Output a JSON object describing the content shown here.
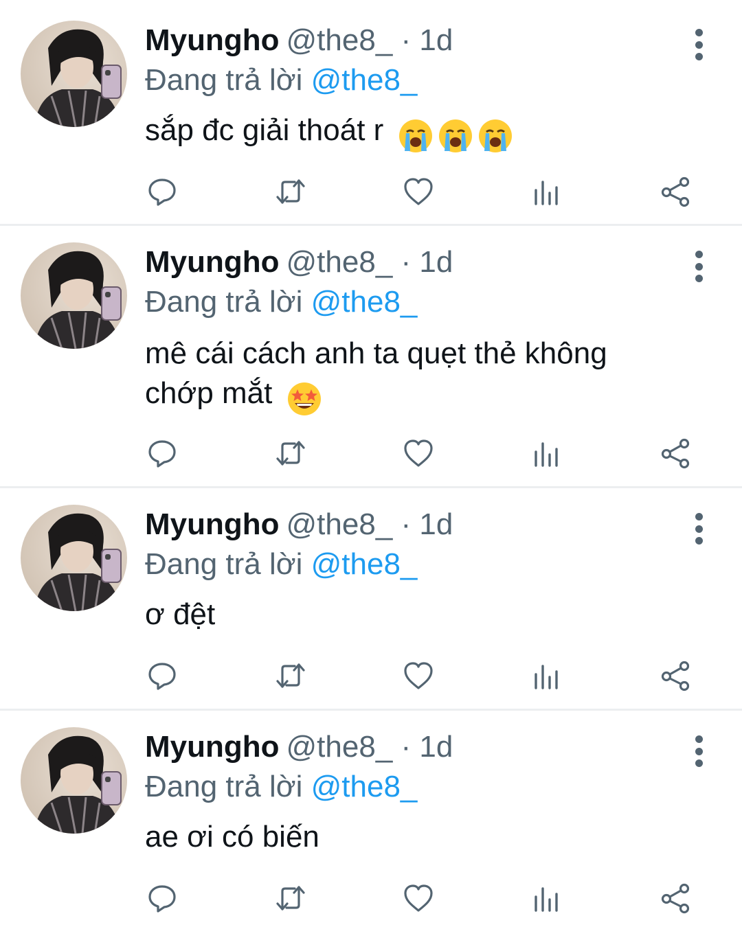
{
  "tweets": [
    {
      "name": "Myungho",
      "handle_time": "@the8_ · 1d",
      "reply_prefix": "Đang trả lời",
      "reply_to": "@the8_",
      "text": "sắp đc giải thoát r",
      "emojis": [
        "loudly-crying-face-emoji",
        "loudly-crying-face-emoji",
        "loudly-crying-face-emoji"
      ]
    },
    {
      "name": "Myungho",
      "handle_time": "@the8_ · 1d",
      "reply_prefix": "Đang trả lời",
      "reply_to": "@the8_",
      "text_line1": "mê cái cách anh ta quẹt thẻ không",
      "text_line2": "chớp mắt",
      "emojis": [
        "star-struck-emoji"
      ]
    },
    {
      "name": "Myungho",
      "handle_time": "@the8_ · 1d",
      "reply_prefix": "Đang trả lời",
      "reply_to": "@the8_",
      "text": "ơ đệt"
    },
    {
      "name": "Myungho",
      "handle_time": "@the8_ · 1d",
      "reply_prefix": "Đang trả lời",
      "reply_to": "@the8_",
      "text": "ae ơi có biến"
    }
  ],
  "action_icons": [
    "reply-icon",
    "retweet-icon",
    "like-icon",
    "views-icon",
    "share-icon"
  ],
  "colors": {
    "text_primary": "#0f1419",
    "text_secondary": "#536471",
    "link": "#1d9bf0",
    "divider": "#eceef0"
  }
}
